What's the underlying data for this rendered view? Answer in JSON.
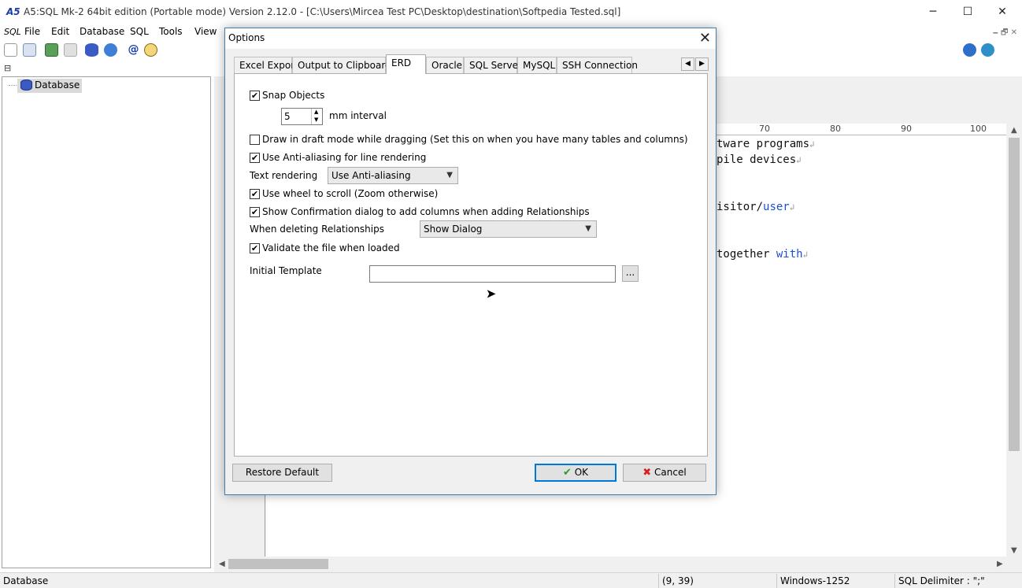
{
  "window": {
    "title": "A5:SQL Mk-2 64bit edition (Portable mode) Version 2.12.0 - [C:\\Users\\Mircea Test PC\\Desktop\\destination\\Softpedia Tested.sql]",
    "minimize": "─",
    "maximize": "☐",
    "close": "✕"
  },
  "menu": {
    "sql_logo": "SQL",
    "items": [
      "File",
      "Edit",
      "Database",
      "SQL",
      "Tools",
      "View"
    ],
    "mdi_buttons": "🗕 🗗 ✕"
  },
  "tree": {
    "root_label": "Database"
  },
  "editor": {
    "ruler": [
      "70",
      "80",
      "90",
      "100"
    ],
    "lines": [
      {
        "text": "tware programs",
        "crlf": "↲"
      },
      {
        "text": "pile devices",
        "crlf": "↲"
      },
      {
        "text": "isitor/",
        "kw": "user",
        "crlf": "↲"
      },
      {
        "text": " together ",
        "kw": "with",
        "crlf": "↲"
      }
    ]
  },
  "statusbar": {
    "left": "Database",
    "position": "(9, 39)",
    "encoding": "Windows-1252",
    "delimiter": "SQL Delimiter : \";\""
  },
  "dialog": {
    "title": "Options",
    "close": "✕",
    "tabs": [
      "Excel Export",
      "Output to Clipboard",
      "ERD",
      "Oracle",
      "SQL Server",
      "MySQL",
      "SSH Connection"
    ],
    "active_tab": "ERD",
    "tab_scroll_left": "◀",
    "tab_scroll_right": "▶",
    "erd": {
      "snap_objects": {
        "label": "Snap Objects",
        "checked": true
      },
      "interval_value": "5",
      "interval_unit": "mm interval",
      "draft_mode": {
        "label": "Draw in draft mode while dragging (Set this on when you have many tables and columns)",
        "checked": false
      },
      "anti_alias_lines": {
        "label": "Use Anti-aliasing for line rendering",
        "checked": true
      },
      "text_rendering_label": "Text rendering",
      "text_rendering_value": "Use Anti-aliasing",
      "wheel_scroll": {
        "label": "Use wheel to scroll (Zoom otherwise)",
        "checked": true
      },
      "confirm_dialog": {
        "label": "Show Confirmation dialog to add columns when adding Relationships",
        "checked": true
      },
      "delete_rel_label": "When deleting Relationships",
      "delete_rel_value": "Show Dialog",
      "validate_file": {
        "label": "Validate the file when loaded",
        "checked": true
      },
      "template_label": "Initial Template",
      "template_value": "",
      "browse_label": "..."
    },
    "buttons": {
      "restore": "Restore Default",
      "ok": "OK",
      "cancel": "Cancel"
    },
    "check_glyph": "✔"
  }
}
